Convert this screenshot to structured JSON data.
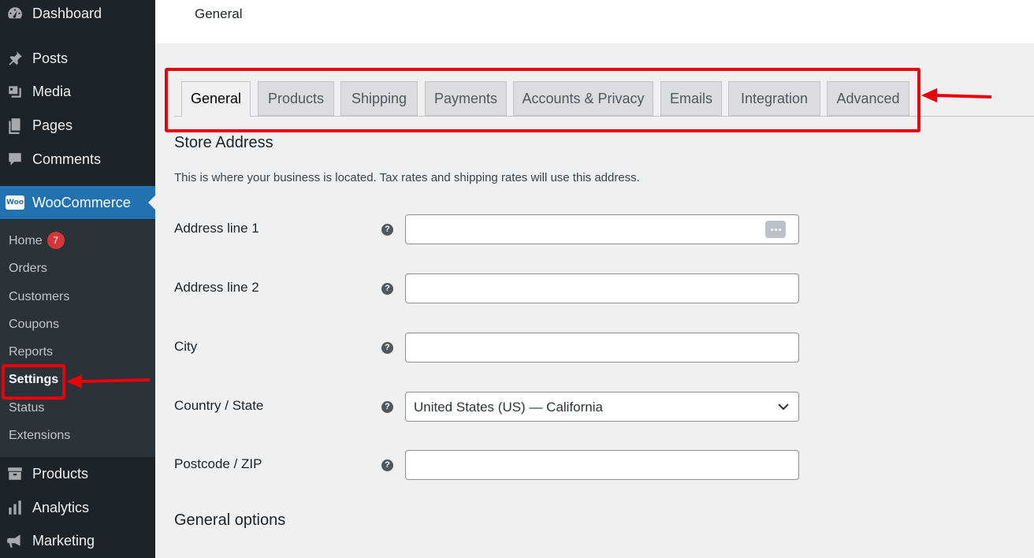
{
  "sidebar": {
    "top_items": [
      {
        "label": "Dashboard",
        "icon": "dashboard-icon"
      },
      {
        "label": "Posts",
        "icon": "pin-icon"
      },
      {
        "label": "Media",
        "icon": "media-icon"
      },
      {
        "label": "Pages",
        "icon": "pages-icon"
      },
      {
        "label": "Comments",
        "icon": "comment-icon"
      },
      {
        "label": "WooCommerce",
        "icon": "woo-logo-icon"
      }
    ],
    "woo_logo_text": "Woo",
    "submenu": [
      {
        "label": "Home",
        "badge": "7"
      },
      {
        "label": "Orders"
      },
      {
        "label": "Customers"
      },
      {
        "label": "Coupons"
      },
      {
        "label": "Reports"
      },
      {
        "label": "Settings"
      },
      {
        "label": "Status"
      },
      {
        "label": "Extensions"
      }
    ],
    "bottom_items": [
      {
        "label": "Products",
        "icon": "archive-icon"
      },
      {
        "label": "Analytics",
        "icon": "bar-chart-icon"
      },
      {
        "label": "Marketing",
        "icon": "megaphone-icon"
      }
    ]
  },
  "header": {
    "title": "General"
  },
  "tabs": [
    {
      "label": "General",
      "active": true
    },
    {
      "label": "Products"
    },
    {
      "label": "Shipping"
    },
    {
      "label": "Payments"
    },
    {
      "label": "Accounts & Privacy"
    },
    {
      "label": "Emails"
    },
    {
      "label": "Integration"
    },
    {
      "label": "Advanced"
    }
  ],
  "store_address": {
    "title": "Store Address",
    "description": "This is where your business is located. Tax rates and shipping rates will use this address.",
    "fields": [
      {
        "label": "Address line 1",
        "value": ""
      },
      {
        "label": "Address line 2",
        "value": ""
      },
      {
        "label": "City",
        "value": ""
      },
      {
        "label": "Country / State",
        "value": "United States (US) — California"
      },
      {
        "label": "Postcode / ZIP",
        "value": ""
      }
    ],
    "help_glyph": "?"
  },
  "general_options": {
    "title": "General options"
  },
  "colors": {
    "sidebar_bg": "#1d2327",
    "submenu_bg": "#2c3338",
    "accent": "#2271b1",
    "badge": "#d63638",
    "annotation_red": "#e8000b"
  }
}
